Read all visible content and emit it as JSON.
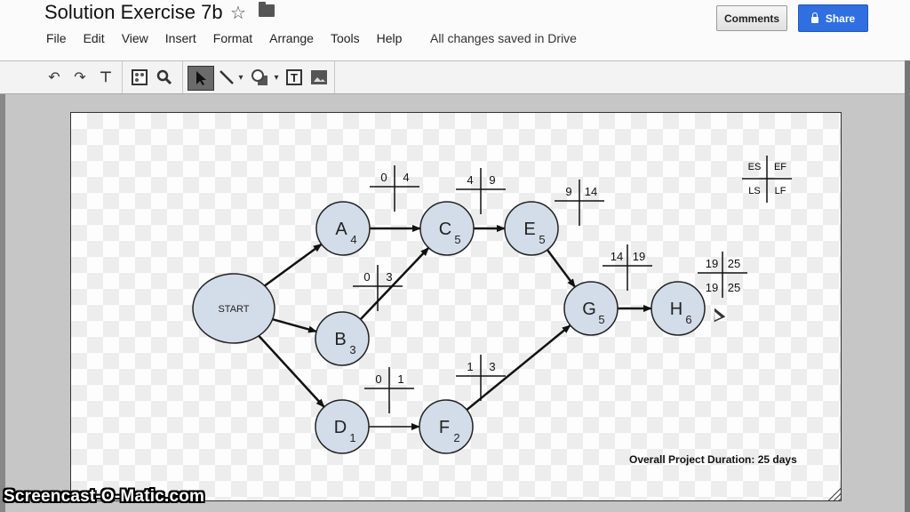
{
  "app": {
    "document_title": "Solution Exercise 7b",
    "menu": [
      "File",
      "Edit",
      "View",
      "Insert",
      "Format",
      "Arrange",
      "Tools",
      "Help"
    ],
    "save_status": "All changes saved in Drive",
    "comments_label": "Comments",
    "share_label": "Share",
    "toolbar_icons": [
      "undo-icon",
      "redo-icon",
      "paint-format-icon",
      "zoom-fit-icon",
      "zoom-icon",
      "select-pointer-icon",
      "line-icon",
      "shape-icon",
      "text-box-icon",
      "image-icon"
    ]
  },
  "diagram": {
    "legend": {
      "es": "ES",
      "ef": "EF",
      "ls": "LS",
      "lf": "LF"
    },
    "start_label": "START",
    "nodes": [
      {
        "id": "A",
        "duration": "4"
      },
      {
        "id": "B",
        "duration": "3"
      },
      {
        "id": "C",
        "duration": "5"
      },
      {
        "id": "D",
        "duration": "1"
      },
      {
        "id": "E",
        "duration": "5"
      },
      {
        "id": "F",
        "duration": "2"
      },
      {
        "id": "G",
        "duration": "5"
      },
      {
        "id": "H",
        "duration": "6"
      }
    ],
    "edges": [
      [
        "START",
        "A"
      ],
      [
        "START",
        "B"
      ],
      [
        "START",
        "D"
      ],
      [
        "A",
        "C"
      ],
      [
        "B",
        "C"
      ],
      [
        "C",
        "E"
      ],
      [
        "E",
        "G"
      ],
      [
        "D",
        "F"
      ],
      [
        "F",
        "G"
      ],
      [
        "G",
        "H"
      ]
    ],
    "time_crosses": [
      {
        "node": "A",
        "es": "0",
        "ef": "4"
      },
      {
        "node": "B",
        "es": "0",
        "ef": "3"
      },
      {
        "node": "C",
        "es": "4",
        "ef": "9"
      },
      {
        "node": "D",
        "es": "0",
        "ef": "1"
      },
      {
        "node": "E",
        "es": "9",
        "ef": "14"
      },
      {
        "node": "F",
        "es": "1",
        "ef": "3"
      },
      {
        "node": "G",
        "es": "14",
        "ef": "19"
      },
      {
        "node": "H",
        "es": "19",
        "ef": "25",
        "ls": "19",
        "lf": "25"
      }
    ],
    "project_duration": "Overall Project Duration: 25 days"
  },
  "watermark": "Screencast-O-Matic.com",
  "colors": {
    "node_fill": "#d3dde9",
    "share_blue": "#2f6fe0"
  }
}
